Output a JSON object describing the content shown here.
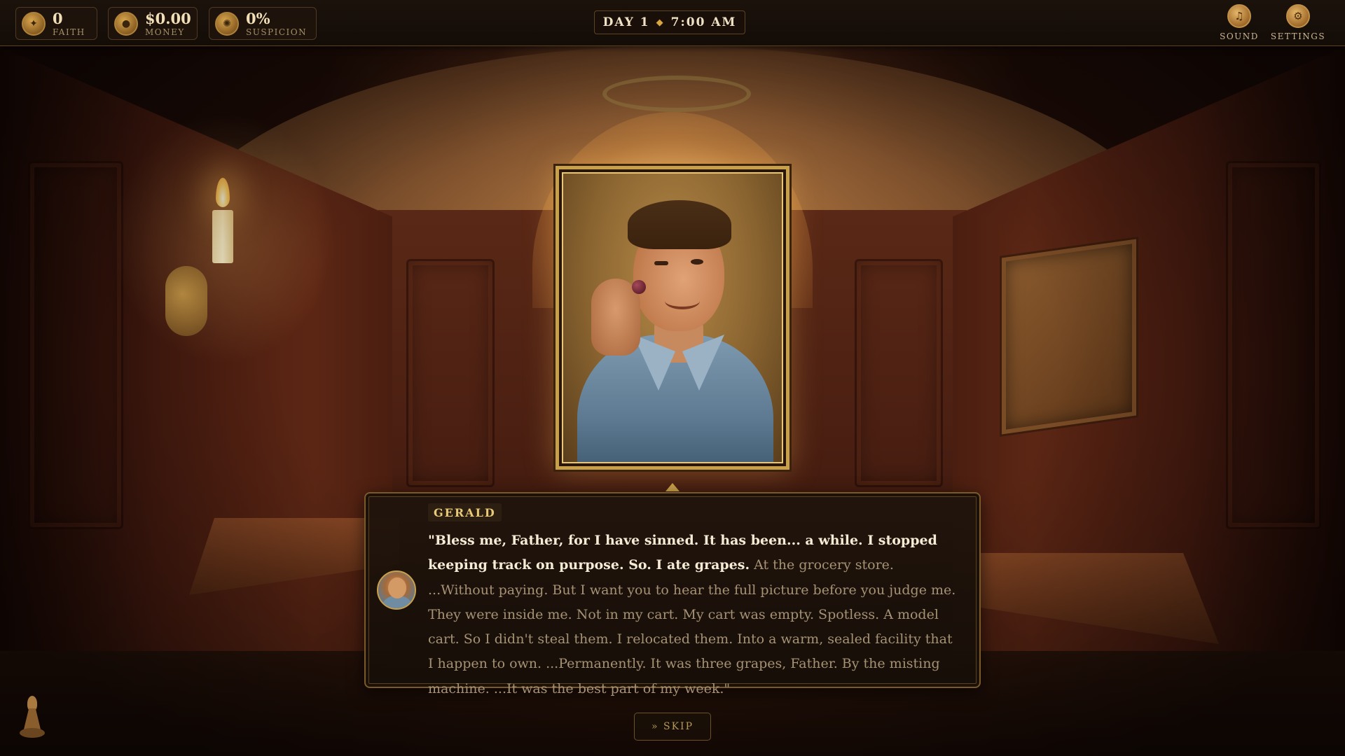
{
  "hud": {
    "stats": [
      {
        "value": "0",
        "label": "Faith",
        "icon": "faith-coin-icon"
      },
      {
        "value": "$0.00",
        "label": "Money",
        "icon": "money-coin-icon"
      },
      {
        "value": "0%",
        "label": "Suspicion",
        "icon": "suspicion-coin-icon"
      }
    ],
    "day": "DAY 1",
    "time": "7:00 AM",
    "separator": "◆",
    "sound_label": "Sound",
    "settings_label": "Settings"
  },
  "dialogue": {
    "speaker": "GERALD",
    "spoken": "\"Bless me, Father, for I have sinned. It has been... a while. I stopped keeping track on purpose. So. I ate grapes.",
    "continuation": " At the grocery store. ...Without paying. But I want you to hear the full picture before you judge me. They were inside me. Not in my cart. My cart was empty. Spotless. A model cart. So I didn't steal them. I relocated them. Into a warm, sealed facility that I happen to own. ...Permanently. It was three grapes, Father. By the misting machine. ...It was the best part of my week.\""
  },
  "skip_label": "» SKIP",
  "colors": {
    "accent_gold": "#c9a04a",
    "text_primary": "#f6ecd6",
    "text_secondary": "#a69274"
  }
}
